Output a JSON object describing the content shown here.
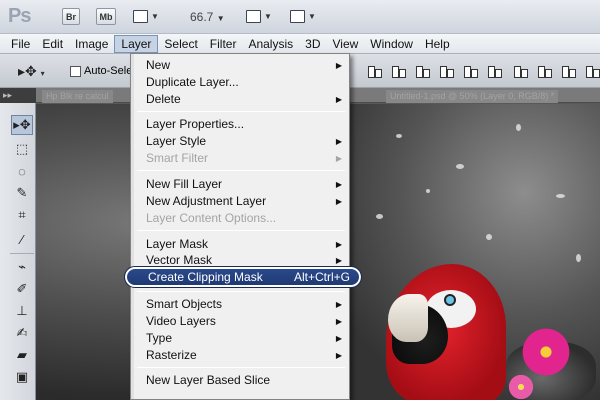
{
  "app": {
    "logo": "Ps",
    "br_label": "Br",
    "mb_label": "Mb",
    "zoom": "66.7"
  },
  "menubar": {
    "items": [
      {
        "label": "File"
      },
      {
        "label": "Edit"
      },
      {
        "label": "Image"
      },
      {
        "label": "Layer"
      },
      {
        "label": "Select"
      },
      {
        "label": "Filter"
      },
      {
        "label": "Analysis"
      },
      {
        "label": "3D"
      },
      {
        "label": "View"
      },
      {
        "label": "Window"
      },
      {
        "label": "Help"
      }
    ]
  },
  "options": {
    "auto_select_label": "Auto-Selec"
  },
  "tabs": {
    "tab1": "Hp Blk re calcul",
    "tab2": "Untitled-1.psd @ 50% (Layer 0, RGB/8) *"
  },
  "layer_menu": {
    "items": [
      {
        "label": "New",
        "submenu": true
      },
      {
        "label": "Duplicate Layer..."
      },
      {
        "label": "Delete",
        "submenu": true
      },
      {
        "label": "Layer Properties..."
      },
      {
        "label": "Layer Style",
        "submenu": true
      },
      {
        "label": "Smart Filter",
        "submenu": true,
        "disabled": true
      },
      {
        "label": "New Fill Layer",
        "submenu": true
      },
      {
        "label": "New Adjustment Layer",
        "submenu": true
      },
      {
        "label": "Layer Content Options...",
        "disabled": true
      },
      {
        "label": "Layer Mask",
        "submenu": true
      },
      {
        "label": "Vector Mask",
        "submenu": true
      },
      {
        "label": "Create Clipping Mask",
        "shortcut": "Alt+Ctrl+G",
        "highlighted": true
      },
      {
        "label": "Smart Objects",
        "submenu": true
      },
      {
        "label": "Video Layers",
        "submenu": true
      },
      {
        "label": "Type",
        "submenu": true
      },
      {
        "label": "Rasterize",
        "submenu": true
      },
      {
        "label": "New Layer Based Slice"
      }
    ]
  },
  "tools": [
    "move-tool",
    "marquee-tool",
    "lasso-tool",
    "quick-select-tool",
    "crop-tool",
    "eyedropper-tool",
    "healing-brush-tool",
    "brush-tool",
    "clone-stamp-tool",
    "history-brush-tool",
    "eraser-tool",
    "gradient-tool"
  ],
  "colors": {
    "menu_highlight": "#203a73",
    "ui_chrome": "#d6dbe2"
  }
}
